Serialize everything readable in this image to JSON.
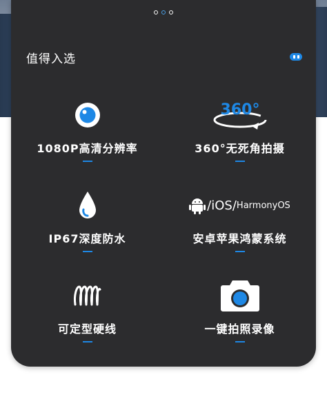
{
  "header": {
    "title": "值得入选"
  },
  "pager": {
    "total": 3,
    "active_index": 1
  },
  "features": [
    {
      "label": "1080P高清分辨率",
      "icon": "camera-lens-icon"
    },
    {
      "label": "360°无死角拍摄",
      "icon": "360-rotation-icon"
    },
    {
      "label": "IP67深度防水",
      "icon": "water-drop-icon"
    },
    {
      "label": "安卓苹果鸿蒙系统",
      "icon": "android-icon"
    },
    {
      "label": "可定型硬线",
      "icon": "coil-cable-icon"
    },
    {
      "label": "一键拍照录像",
      "icon": "camera-icon"
    }
  ],
  "os_badges": {
    "ios": "iOS",
    "harmony": "HarmonyOS",
    "separator": "/"
  },
  "rotation_text": "360°",
  "colors": {
    "card": "#2c2c2e",
    "accent": "#1e88e5",
    "text": "#ffffff"
  }
}
